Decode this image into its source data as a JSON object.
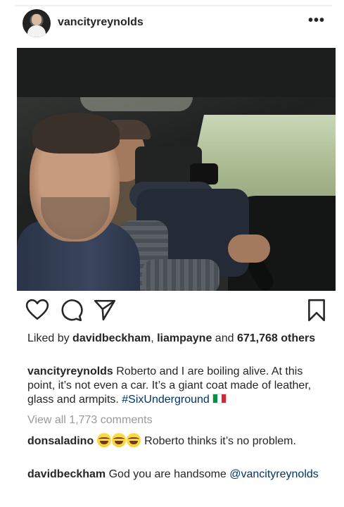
{
  "post": {
    "username": "vancityreynolds",
    "more_icon": "more-horizontal-icon",
    "more_label": "•••"
  },
  "actions": {
    "like": "heart-icon",
    "comment": "comment-icon",
    "share": "send-icon",
    "save": "bookmark-icon"
  },
  "likes": {
    "prefix": "Liked by ",
    "user1": "davidbeckham",
    "sep": ", ",
    "user2": "liampayne",
    "and": " and ",
    "count": "671,768 others"
  },
  "caption": {
    "username": "vancityreynolds",
    "text": " Roberto and I are boiling alive. At this point, it’s not even a car. It’s a giant coat made of leather, glass and armpits. ",
    "hashtag": "#SixUnderground",
    "flag_icon": "italy-flag-icon"
  },
  "view_all_comments": "View all 1,773 comments",
  "comments": [
    {
      "username": "donsaladino",
      "emoji": "laughing-emoji-icon",
      "emoji_count": 3,
      "text": " Roberto thinks it’s no problem."
    },
    {
      "username": "davidbeckham",
      "text": " God you are handsome ",
      "mention": "@vancityreynolds"
    }
  ],
  "colors": {
    "text": "#262626",
    "link": "#003569",
    "muted": "#999999"
  }
}
